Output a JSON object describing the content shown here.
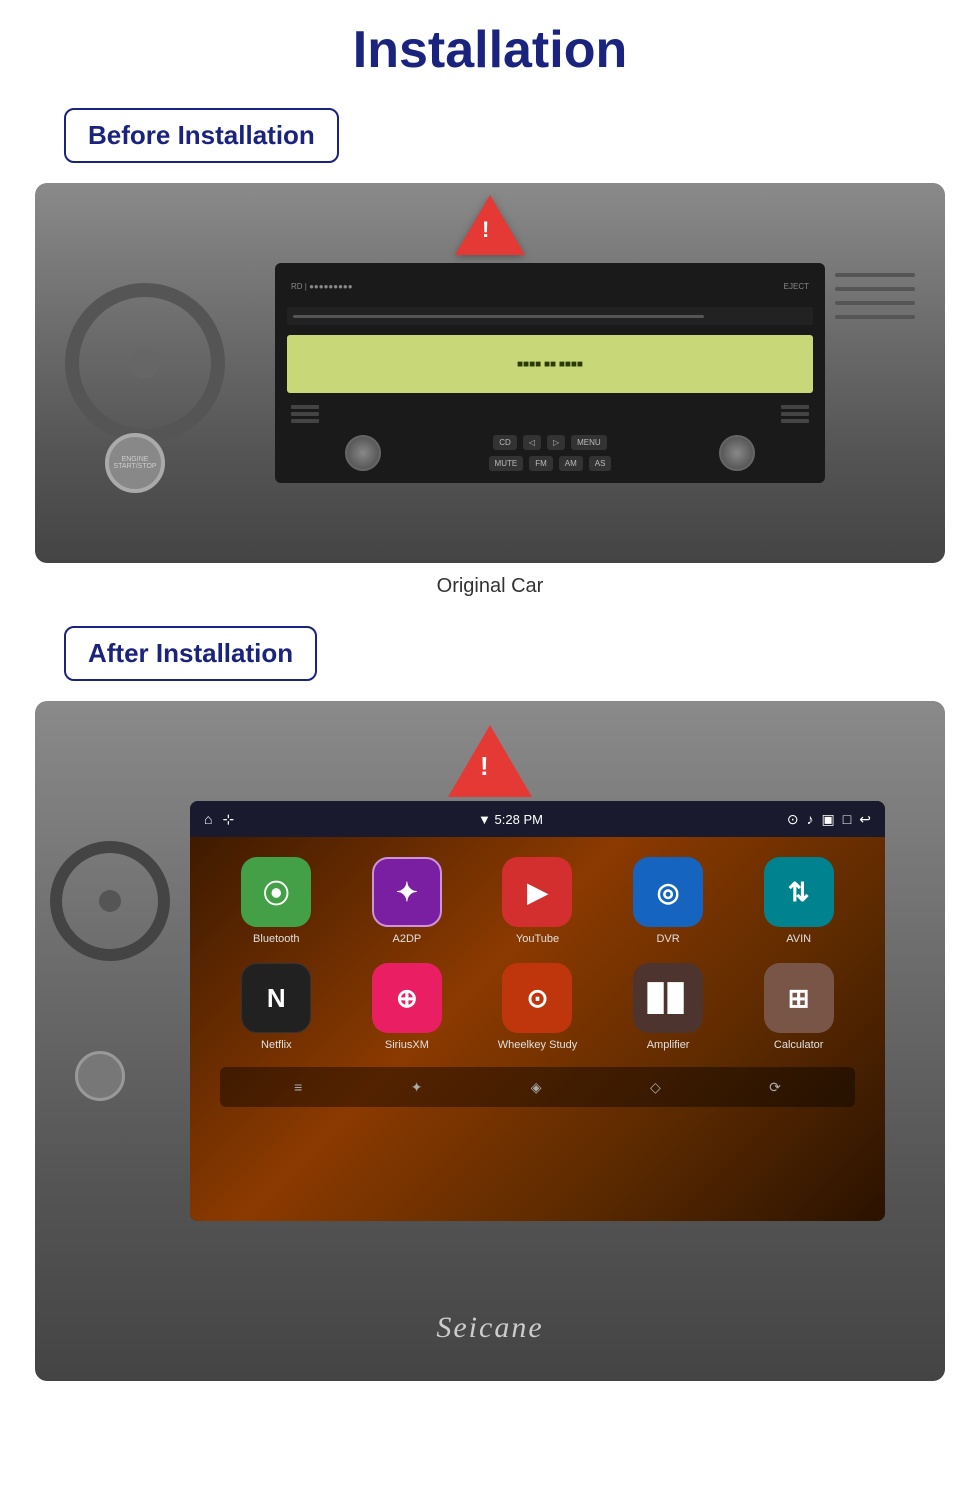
{
  "page": {
    "title": "Installation"
  },
  "before": {
    "badge_text": "Before Installation",
    "caption": "Original Car"
  },
  "after": {
    "badge_text": "After Installation"
  },
  "android": {
    "statusbar": {
      "wifi": "▼",
      "time": "5:28 PM"
    },
    "apps": [
      {
        "name": "Bluetooth",
        "icon_class": "icon-bluetooth",
        "symbol": "⦿"
      },
      {
        "name": "A2DP",
        "icon_class": "icon-a2dp",
        "symbol": "✦"
      },
      {
        "name": "YouTube",
        "icon_class": "icon-youtube",
        "symbol": "▶"
      },
      {
        "name": "DVR",
        "icon_class": "icon-dvr",
        "symbol": "◎"
      },
      {
        "name": "AVIN",
        "icon_class": "icon-avin",
        "symbol": "⇅"
      },
      {
        "name": "Netflix",
        "icon_class": "icon-netflix",
        "symbol": "N"
      },
      {
        "name": "SiriusXM",
        "icon_class": "icon-siriusxm",
        "symbol": "⊕"
      },
      {
        "name": "Wheelkey Study",
        "icon_class": "icon-wheelkey",
        "symbol": "⊙"
      },
      {
        "name": "Amplifier",
        "icon_class": "icon-amplifier",
        "symbol": "▊▊"
      },
      {
        "name": "Calculator",
        "icon_class": "icon-calculator",
        "symbol": "⊞"
      }
    ]
  },
  "seicane": {
    "logo": "Seicane"
  }
}
